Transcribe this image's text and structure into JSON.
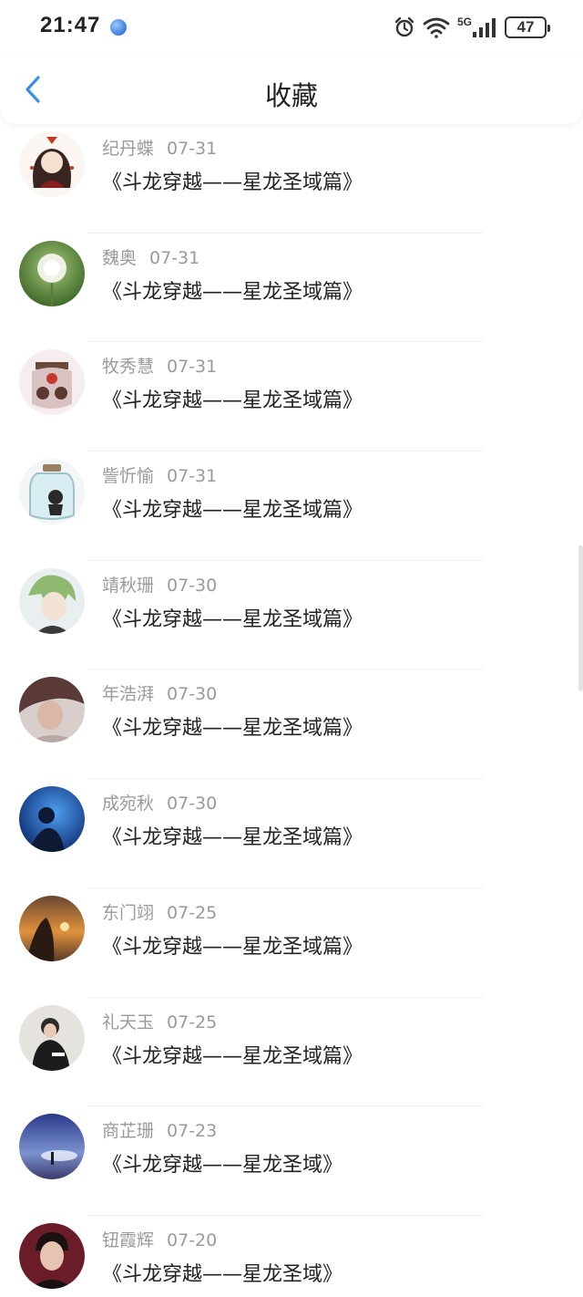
{
  "status_bar": {
    "time": "21:47",
    "network": "5G",
    "battery": "47"
  },
  "header": {
    "title": "收藏",
    "back_icon": "chevron-left-icon"
  },
  "colors": {
    "accent": "#3a8ee6",
    "meta_text": "#9a9a9a",
    "divider": "#efefef"
  },
  "items": [
    {
      "name": "纪丹蝶",
      "date": "07-31",
      "book": "《斗龙穿越——星龙圣域篇》"
    },
    {
      "name": "魏奥",
      "date": "07-31",
      "book": "《斗龙穿越——星龙圣域篇》"
    },
    {
      "name": "牧秀慧",
      "date": "07-31",
      "book": "《斗龙穿越——星龙圣域篇》"
    },
    {
      "name": "訾忻愉",
      "date": "07-31",
      "book": "《斗龙穿越——星龙圣域篇》"
    },
    {
      "name": "靖秋珊",
      "date": "07-30",
      "book": "《斗龙穿越——星龙圣域篇》"
    },
    {
      "name": "年浩湃",
      "date": "07-30",
      "book": "《斗龙穿越——星龙圣域篇》"
    },
    {
      "name": "成宛秋",
      "date": "07-30",
      "book": "《斗龙穿越——星龙圣域篇》"
    },
    {
      "name": "东门翊",
      "date": "07-25",
      "book": "《斗龙穿越——星龙圣域篇》"
    },
    {
      "name": "礼天玉",
      "date": "07-25",
      "book": "《斗龙穿越——星龙圣域篇》"
    },
    {
      "name": "商芷珊",
      "date": "07-23",
      "book": "《斗龙穿越——星龙圣域》"
    },
    {
      "name": "钮霞辉",
      "date": "07-20",
      "book": "《斗龙穿越——星龙圣域》"
    }
  ]
}
